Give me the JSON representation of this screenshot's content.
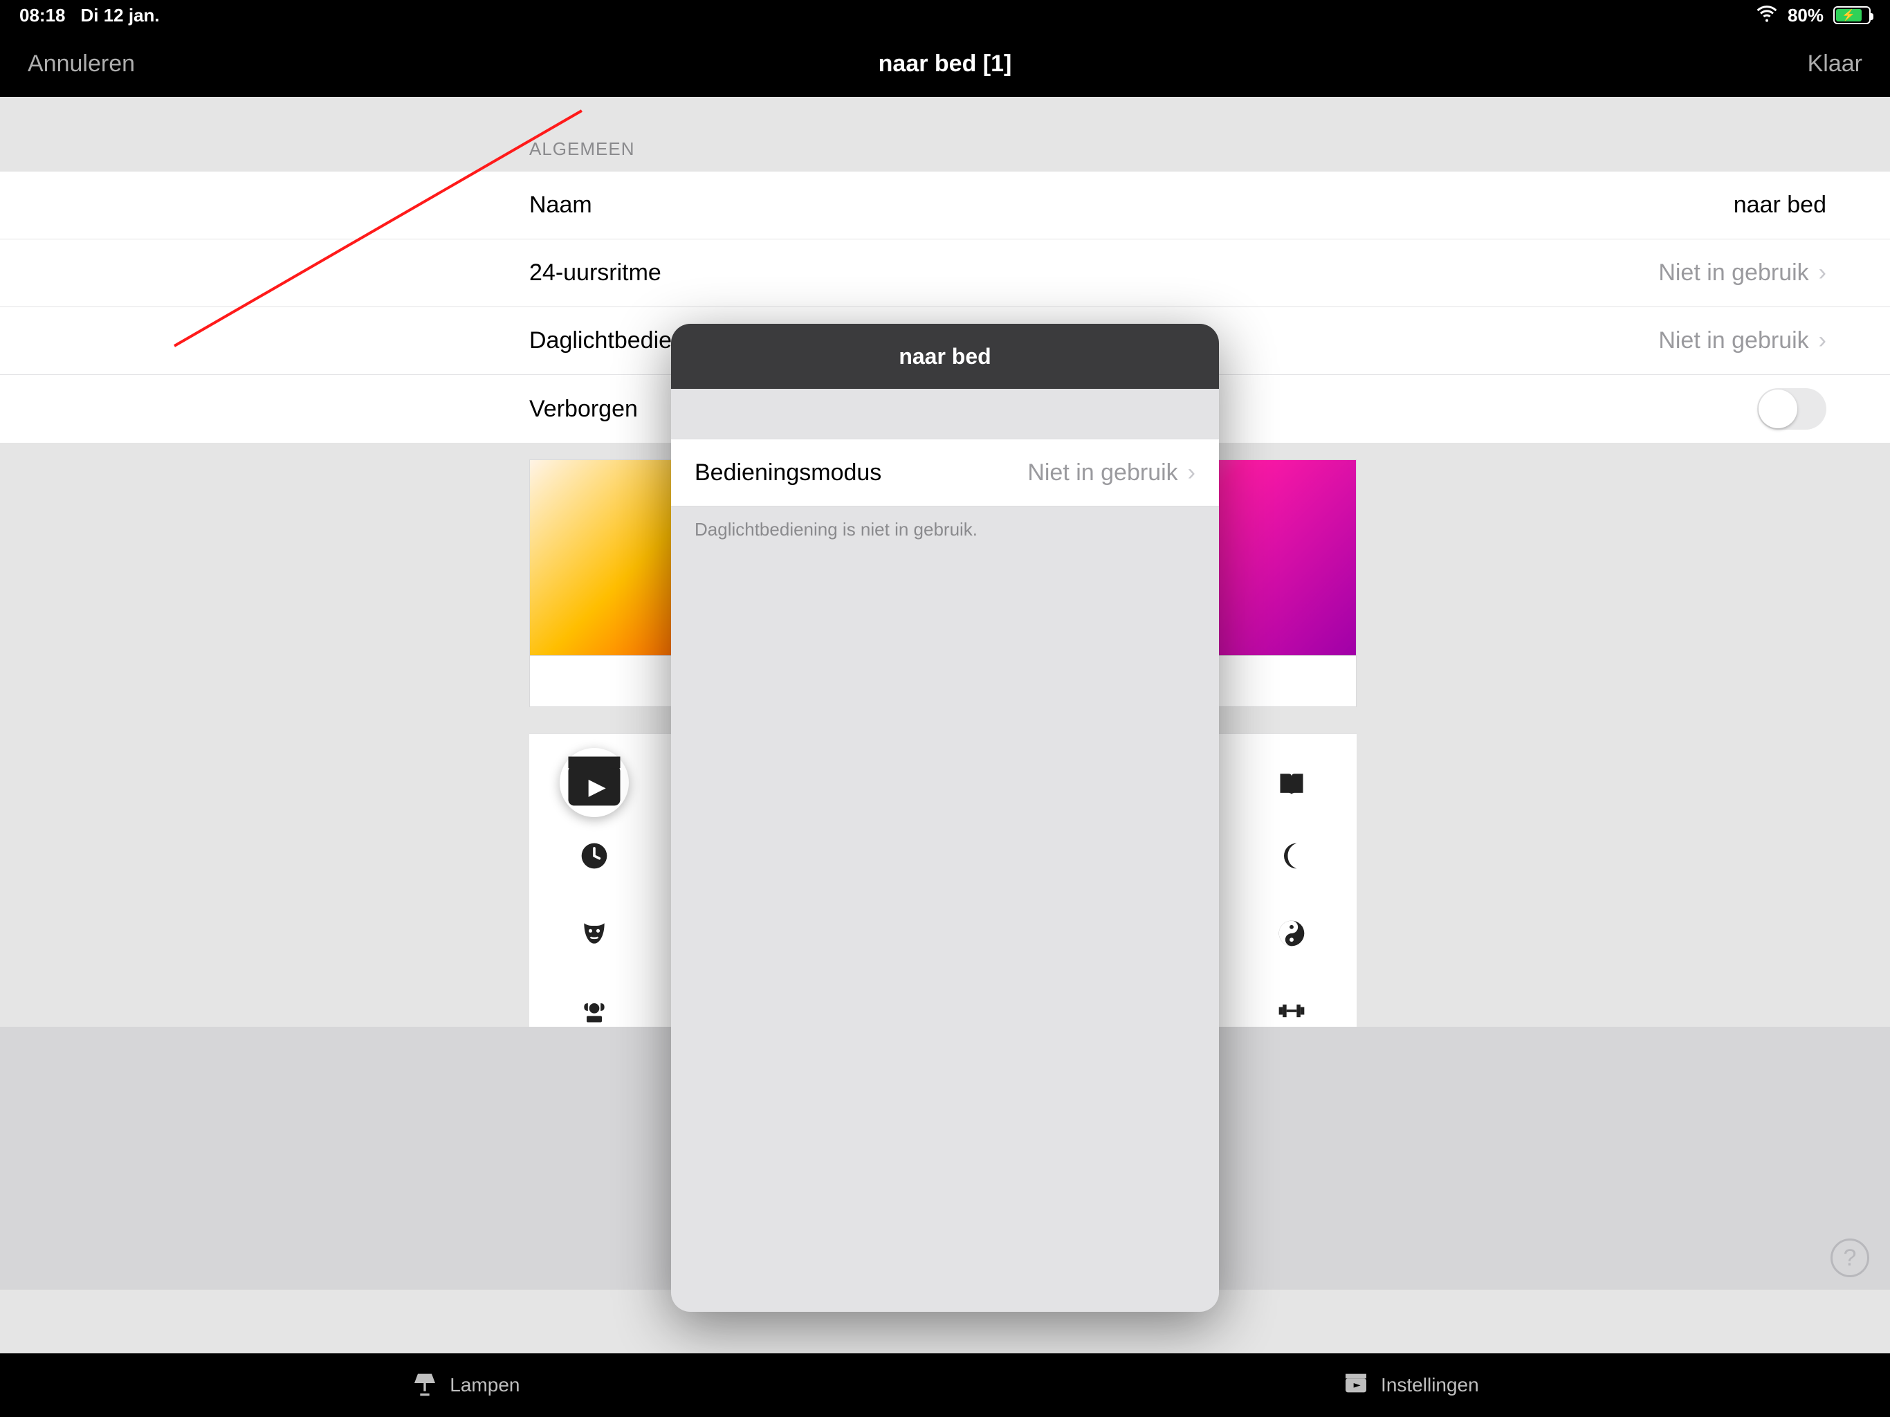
{
  "status": {
    "time": "08:18",
    "date": "Di 12 jan.",
    "battery_pct": "80%"
  },
  "nav": {
    "cancel": "Annuleren",
    "title": "naar bed [1]",
    "done": "Klaar"
  },
  "section_general": "ALGEMEEN",
  "rows": {
    "name_label": "Naam",
    "name_value": "naar bed",
    "rhythm_label": "24-uursritme",
    "rhythm_value": "Niet in gebruik",
    "daylight_label": "Daglichtbediening",
    "daylight_value": "Niet in gebruik",
    "hidden_label": "Verborgen"
  },
  "popover": {
    "title": "naar bed",
    "mode_label": "Bedieningsmodus",
    "mode_value": "Niet in gebruik",
    "note": "Daglichtbediening is niet in gebruik."
  },
  "tabs": {
    "lamps": "Lampen",
    "settings": "Instellingen"
  },
  "help": "?"
}
